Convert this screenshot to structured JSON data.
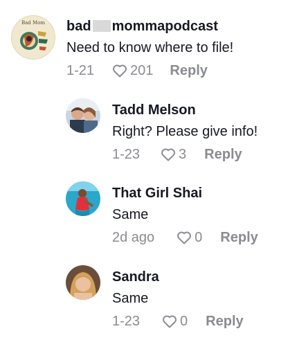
{
  "comments": [
    {
      "username_start": "bad",
      "username_end": "mommapodcast",
      "username_redacted": true,
      "avatar": "podcast-logo-avatar",
      "text": "Need to know where to file!",
      "date": "1-21",
      "likes": "201",
      "reply_label": "Reply"
    },
    {
      "username": "Tadd Melson",
      "avatar": "couple-photo-avatar",
      "text": "Right? Please give info!",
      "date": "1-23",
      "likes": "3",
      "reply_label": "Reply"
    },
    {
      "username": "That Girl Shai",
      "avatar": "beach-photo-avatar",
      "text": "Same",
      "date": "2d ago",
      "likes": "0",
      "reply_label": "Reply"
    },
    {
      "username": "Sandra",
      "avatar": "portrait-photo-avatar",
      "text": "Same",
      "date": "1-23",
      "likes": "0",
      "reply_label": "Reply"
    }
  ],
  "icons": {
    "like": "heart-outline-icon"
  },
  "colors": {
    "text": "#161823",
    "secondary": "#8a8b91"
  }
}
